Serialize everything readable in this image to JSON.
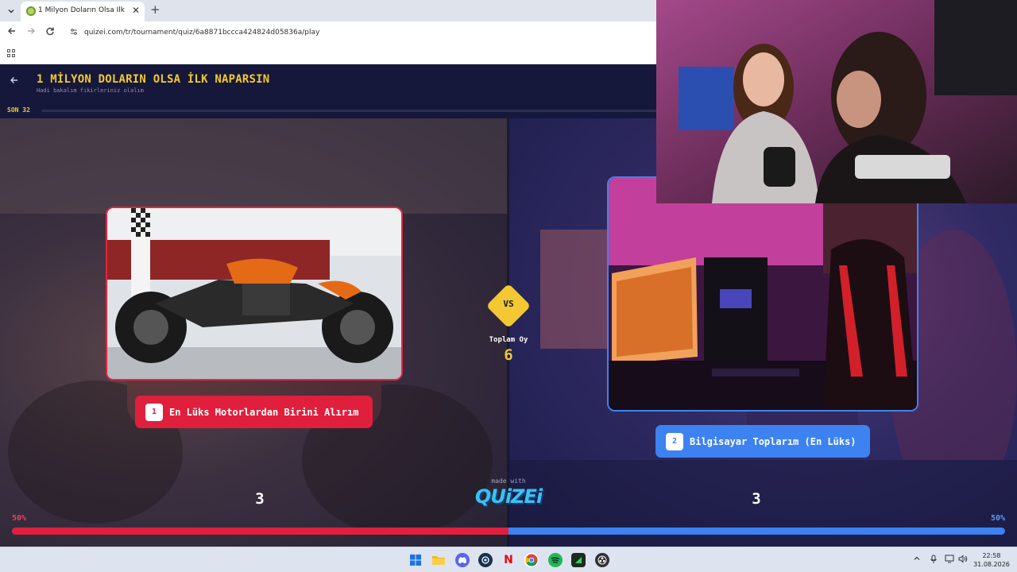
{
  "browser": {
    "tab_title": "1 Milyon Doların Olsa İlk Naparsın",
    "tab_close": "✕",
    "new_tab": "+",
    "url": "quizei.com/tr/tournament/quiz/6a8871bccca424824d05836a/play"
  },
  "quiz": {
    "title": "1 MİLYON DOLARIN OLSA İLK NAPARSIN",
    "subtitle": "Hadi bakalım fikirleriniz olalım",
    "round": "SON 32",
    "vs": "VS",
    "total_votes_label": "Toplam Oy",
    "total_votes": "6",
    "made_with": "made with",
    "brand": "QUiZEi"
  },
  "options": [
    {
      "number": "1",
      "label": "En Lüks Motorlardan Birini Alırım",
      "votes": "3",
      "percent": "50%"
    },
    {
      "number": "2",
      "label": "Bilgisayar Toplarım (En Lüks)",
      "votes": "3",
      "percent": "50%"
    }
  ],
  "result_share_left": 0.5,
  "colors": {
    "accent_yellow": "#f3c832",
    "option1_red": "#e01f3d",
    "option2_blue": "#3d82f1"
  },
  "taskbar": {
    "time": "22:58",
    "date": "31.08.2026",
    "apps": [
      "windows-start-icon",
      "file-explorer-icon",
      "discord-icon",
      "steam-icon",
      "netflix-icon",
      "chrome-icon",
      "spotify-icon",
      "terminal-icon",
      "obs-icon"
    ]
  }
}
